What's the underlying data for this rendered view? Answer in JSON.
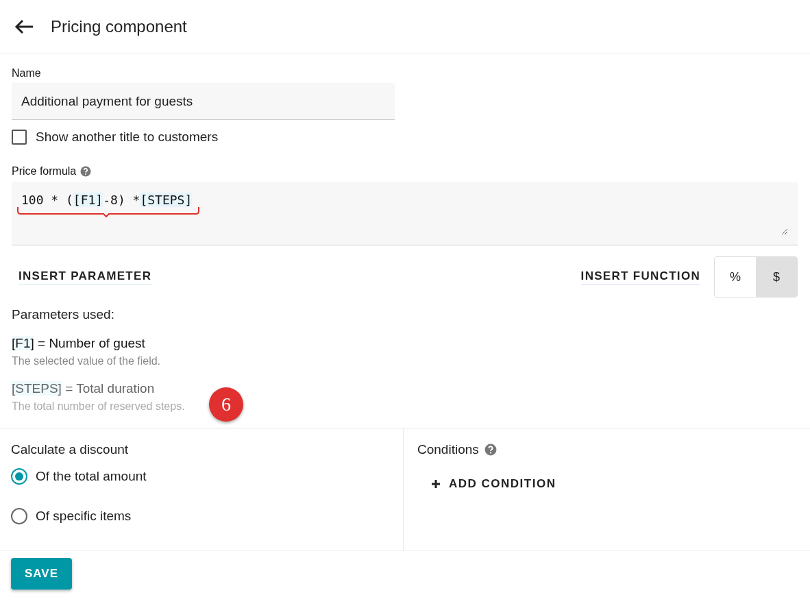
{
  "header": {
    "title": "Pricing component"
  },
  "name_field": {
    "label": "Name",
    "value": "Additional payment for guests"
  },
  "alt_title": {
    "label": "Show another title to customers",
    "checked": false
  },
  "formula": {
    "label": "Price formula",
    "parts": [
      {
        "text": "100 * (",
        "kind": "plain"
      },
      {
        "text": "[F1]",
        "kind": "token"
      },
      {
        "text": "-8) *",
        "kind": "plain"
      },
      {
        "text": "[STEPS]",
        "kind": "token"
      }
    ]
  },
  "actions": {
    "insert_parameter": "INSERT PARAMETER",
    "insert_function": "INSERT FUNCTION",
    "units": [
      {
        "label": "%",
        "selected": false
      },
      {
        "label": "$",
        "selected": true
      }
    ]
  },
  "parameters": {
    "title": "Parameters used:",
    "items": [
      {
        "token": "[F1]",
        "name": "= Number of guest",
        "description": "The selected value of the field.",
        "dimmed": false
      },
      {
        "token": "[STEPS]",
        "name": "= Total duration",
        "description": "The total number of reserved steps.",
        "dimmed": true
      }
    ]
  },
  "annotation": {
    "badge": "6"
  },
  "discount": {
    "title": "Calculate a discount",
    "options": [
      {
        "label": "Of the total amount",
        "selected": true
      },
      {
        "label": "Of specific items",
        "selected": false
      }
    ]
  },
  "conditions": {
    "title": "Conditions",
    "add": "ADD CONDITION"
  },
  "save": "SAVE"
}
